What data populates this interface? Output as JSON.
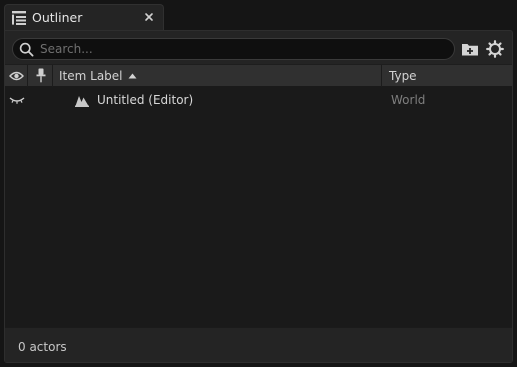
{
  "tab": {
    "title": "Outliner",
    "icon": "outliner-list-icon",
    "close_icon": "close-icon"
  },
  "toolbar": {
    "search_placeholder": "Search...",
    "search_value": "",
    "add_folder_icon": "add-folder-icon",
    "settings_icon": "gear-icon"
  },
  "columns": {
    "visibility_icon": "eye-icon",
    "pin_icon": "pin-icon",
    "item_label": "Item Label",
    "sort_icon": "sort-ascending-icon",
    "type": "Type"
  },
  "rows": [
    {
      "label": "Untitled (Editor)",
      "type": "World",
      "icon": "world-level-icon",
      "visibility_icon": "eye-closed-icon"
    }
  ],
  "footer": {
    "status": "0 actors"
  },
  "colors": {
    "background": "#151515",
    "panel": "#242424",
    "header": "#303030",
    "rows_bg": "#1a1a1a",
    "text": "#d8d8d8",
    "muted_text": "#7e7e7e"
  }
}
